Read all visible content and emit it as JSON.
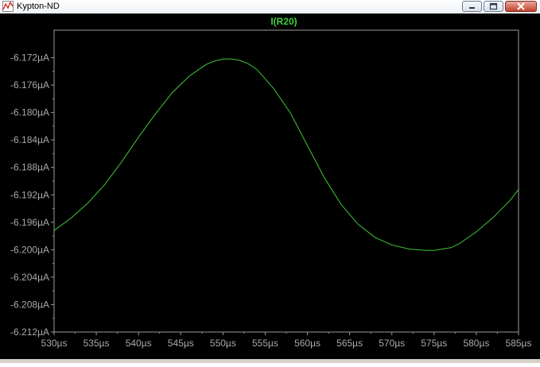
{
  "window": {
    "title": "Kypton-ND",
    "icon": "waveform-icon",
    "buttons": {
      "minimize": "minimize-icon",
      "maximize": "maximize-icon",
      "close": "close-icon"
    }
  },
  "colors": {
    "plot_background": "#000000",
    "trace": "#41c738",
    "axis": "#9a9a9a",
    "tick_label": "#a9a9a9",
    "title": "#3fd13a"
  },
  "chart_data": {
    "type": "line",
    "title": "I(R20)",
    "xlabel": "",
    "ylabel": "",
    "x_unit": "µs",
    "y_unit": "µA",
    "xlim": [
      530,
      585
    ],
    "ylim": [
      -6.212,
      -6.168
    ],
    "x_ticks": [
      "530µs",
      "535µs",
      "540µs",
      "545µs",
      "550µs",
      "555µs",
      "560µs",
      "565µs",
      "570µs",
      "575µs",
      "580µs",
      "585µs"
    ],
    "y_ticks": [
      "-6.172µA",
      "-6.176µA",
      "-6.180µA",
      "-6.184µA",
      "-6.188µA",
      "-6.192µA",
      "-6.196µA",
      "-6.200µA",
      "-6.204µA",
      "-6.208µA",
      "-6.212µA"
    ],
    "grid": false,
    "series": [
      {
        "name": "I(R20)",
        "x": [
          530,
          532,
          534,
          536,
          538,
          540,
          542,
          544,
          546,
          548,
          549,
          550,
          550.5,
          551,
          551.5,
          552,
          553,
          554,
          556,
          558,
          560,
          562,
          564,
          566,
          568,
          570,
          572,
          574,
          575,
          575.5,
          576,
          576.5,
          577,
          578,
          580,
          582,
          584,
          585
        ],
        "y": [
          -6.1972,
          -6.1954,
          -6.1932,
          -6.1905,
          -6.1872,
          -6.1836,
          -6.1802,
          -6.1771,
          -6.1747,
          -6.173,
          -6.1725,
          -6.1722,
          -6.1722,
          -6.1722,
          -6.1723,
          -6.1724,
          -6.1729,
          -6.1737,
          -6.1765,
          -6.1801,
          -6.1848,
          -6.1895,
          -6.1934,
          -6.1963,
          -6.1982,
          -6.1993,
          -6.1999,
          -6.2001,
          -6.2001,
          -6.2,
          -6.1999,
          -6.1998,
          -6.1997,
          -6.1991,
          -6.1974,
          -6.1953,
          -6.1928,
          -6.1912
        ]
      }
    ]
  }
}
